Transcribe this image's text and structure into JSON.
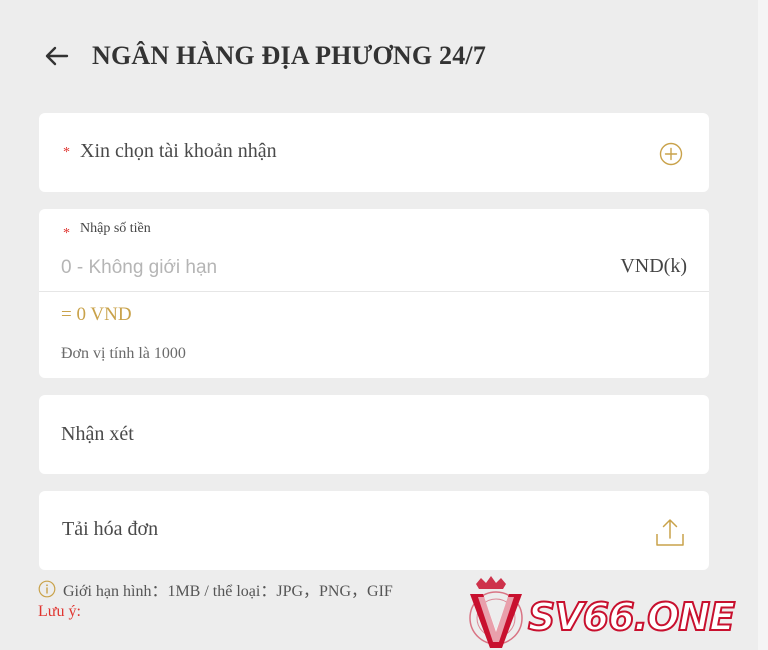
{
  "header": {
    "title": "NGÂN HÀNG ĐỊA PHƯƠNG 24/7",
    "back_icon": "arrow-left-icon"
  },
  "account": {
    "required_mark": "*",
    "label": "Xin chọn tài khoản nhận",
    "add_icon": "circle-plus-icon"
  },
  "amount": {
    "required_mark": "*",
    "label": "Nhập số tiền",
    "placeholder": "0 - Không giới hạn",
    "value": "",
    "unit": "VND(k)",
    "converted": "= 0 VND",
    "hint": "Đơn vị tính là 1000"
  },
  "note": {
    "placeholder": "Nhận xét",
    "value": ""
  },
  "invoice": {
    "label": "Tải hóa đơn",
    "upload_icon": "upload-icon"
  },
  "footer": {
    "info_icon": "info-circle-icon",
    "limit_text": "Giới hạn hình：1MB / thể loại：JPG，PNG，GIF",
    "caution_label": "Lưu ý:"
  },
  "watermark": {
    "text": "SV66.ONE"
  },
  "colors": {
    "accent": "#c9a24a",
    "required": "#e0342f",
    "background": "#ededed",
    "card": "#ffffff",
    "brand": "#c8102e"
  }
}
